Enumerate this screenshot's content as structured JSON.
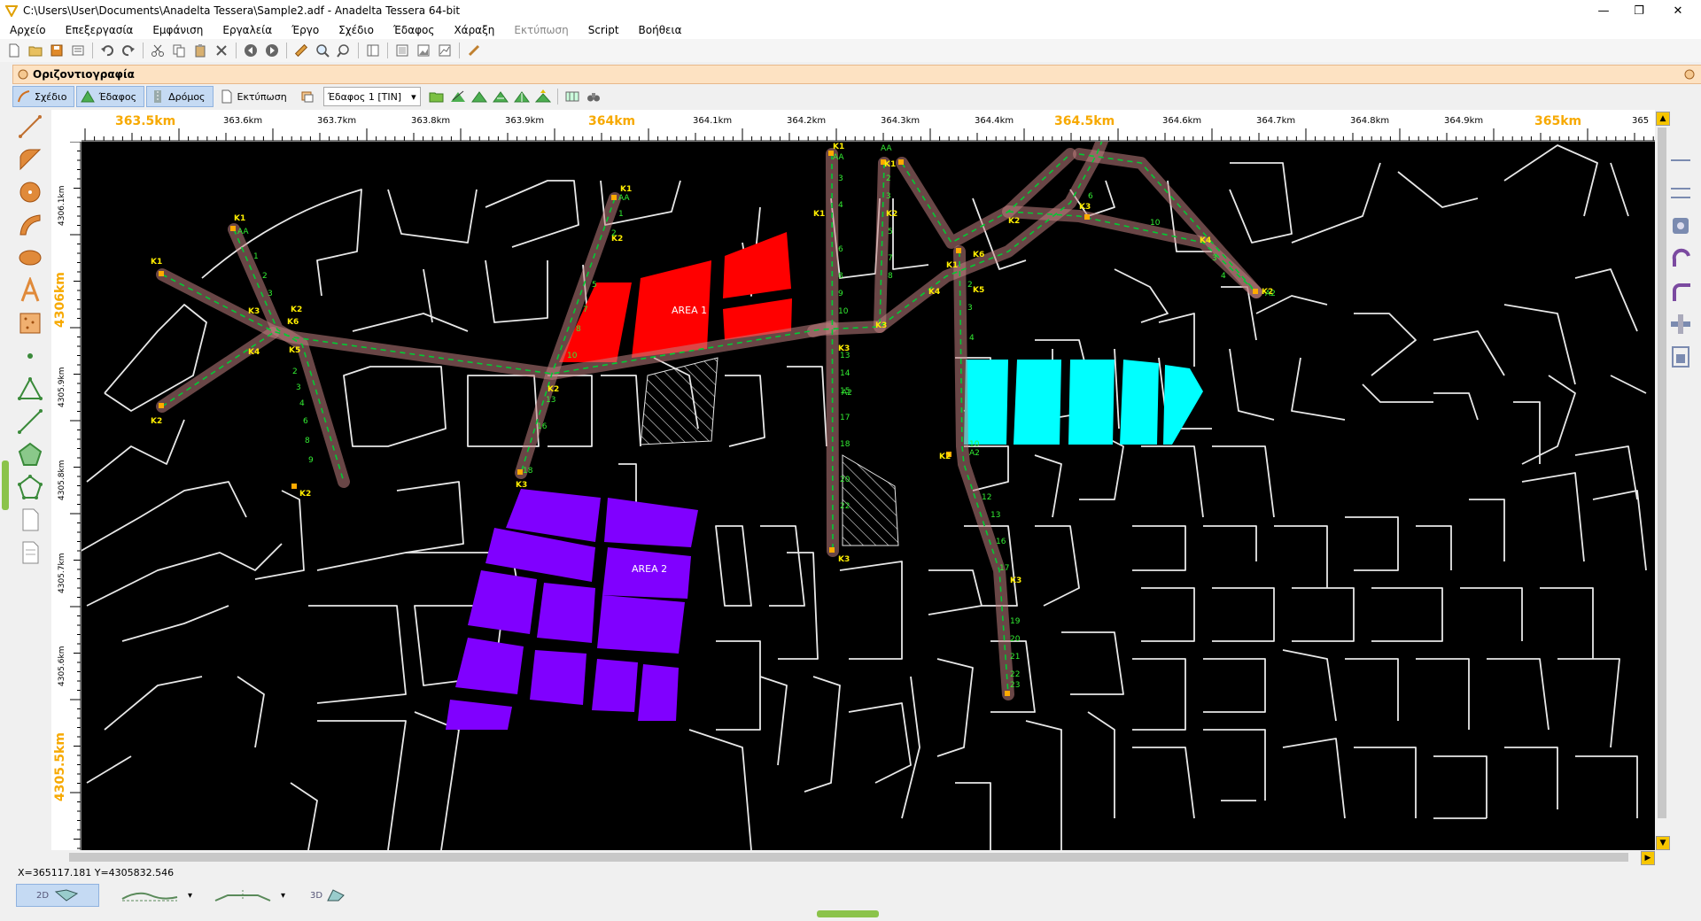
{
  "window": {
    "title": "C:\\Users\\User\\Documents\\Anadelta Tessera\\Sample2.adf - Anadelta Tessera 64-bit",
    "minimize_glyph": "—",
    "maximize_glyph": "❐",
    "close_glyph": "✕"
  },
  "menu": [
    "Αρχείο",
    "Επεξεργασία",
    "Εμφάνιση",
    "Εργαλεία",
    "Έργο",
    "Σχέδιο",
    "Έδαφος",
    "Χάραξη",
    "Εκτύπωση",
    "Script",
    "Βοήθεια"
  ],
  "menu_disabled": "Εκτύπωση",
  "panel": {
    "title": "Οριζοντιογραφία",
    "tabs": [
      "Σχέδιο",
      "Έδαφος",
      "Δρόμος",
      "Εκτύπωση"
    ],
    "active_tab": "Έδαφος",
    "terrain_combo": "Έδαφος 1 [TIN]",
    "combo_arrow": "▾"
  },
  "rulers": {
    "top_major": [
      "363.5km",
      "364km",
      "364.5km",
      "365km"
    ],
    "top_minor": [
      "363.6km",
      "363.7km",
      "363.8km",
      "363.9km",
      "364.1km",
      "364.2km",
      "364.3km",
      "364.4km",
      "364.6km",
      "364.7km",
      "364.8km",
      "364.9km",
      "365"
    ],
    "left_major": [
      "4306km",
      "4305.5km"
    ],
    "left_minor": [
      "4306.1km",
      "4305.9km",
      "4305.8km",
      "4305.7km",
      "4305.6km"
    ]
  },
  "map": {
    "areas": [
      "AREA 1",
      "AREA 2"
    ],
    "colors": {
      "background": "#000000",
      "streets": "#e8e8e8",
      "area1": "#ff0000",
      "area2": "#8000ff",
      "area3": "#00ffff",
      "road_centerline": "#00cc33",
      "road_edge": "#c08080",
      "station_label": "#33ee33",
      "vertex_label": "#ffee00",
      "vertex_marker": "#ffaa00"
    },
    "vertex_labels": [
      "K1",
      "K2",
      "K3",
      "K4",
      "K5",
      "K6",
      "AA",
      "A2"
    ],
    "station_labels": [
      "1",
      "2",
      "3",
      "4",
      "5",
      "6",
      "7",
      "8",
      "9",
      "10",
      "11",
      "12",
      "13",
      "14",
      "15",
      "16",
      "17",
      "18",
      "19",
      "20",
      "21",
      "22",
      "23"
    ]
  },
  "status": {
    "coords": "X=365117.181  Y=4305832.546"
  },
  "bottom": {
    "view_2d": "2D",
    "view_3d": "3D",
    "dropdown": "▾"
  },
  "scroll": {
    "up": "▲",
    "down": "▼",
    "left": "◀",
    "right": "▶"
  },
  "icons": {
    "app": "app-logo-icon",
    "left_tools": [
      "line-icon",
      "arc-icon",
      "circle-icon",
      "curve-icon",
      "ellipse-icon",
      "text-icon",
      "hatch-icon",
      "point-icon",
      "triangle-icon",
      "polyline-icon",
      "polygon-icon",
      "region-icon",
      "page-icon",
      "sheet-icon"
    ],
    "right_tools": [
      "line-tool-icon",
      "align-icon",
      "layer-icon",
      "rotate-icon",
      "fillet-icon",
      "split-icon",
      "section-icon"
    ]
  }
}
